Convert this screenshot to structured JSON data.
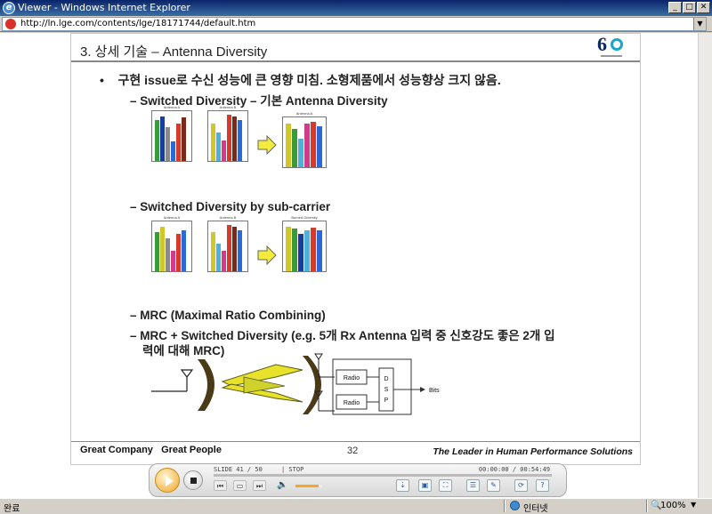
{
  "window": {
    "title": "Viewer - Windows Internet Explorer",
    "minimize": "_",
    "maximize": "□",
    "close": "✕"
  },
  "address": {
    "url": "http://ln.lge.com/contents/lge/18171744/default.htm"
  },
  "slide": {
    "title": "3. 상세 기술 – Antenna Diversity",
    "bullet_main": "구현 issue로 수신 성능에 큰 영향 미침. 소형제품에서 성능향상 크지 않음.",
    "dash_1": "– Switched Diversity – 기본 Antenna Diversity",
    "dash_2": "– Switched Diversity by sub-carrier",
    "dash_3": "– MRC (Maximal Ratio Combining)",
    "dash_4_line1": "– MRC + Switched Diversity (e.g. 5개 Rx Antenna 입력 중 신호강도 좋은 2개 입",
    "dash_4_line2": "력에 대해 MRC)",
    "row1_captions": [
      "Antenna A",
      "Antenna B",
      "Antenna A"
    ],
    "row2_captions": [
      "Antenna A",
      "Antenna B",
      "Burned Diversity"
    ],
    "diagram": {
      "radio_top": "Radio",
      "radio_bottom": "Radio",
      "dsp": "D\nS\nP",
      "output": "Bits"
    },
    "footer_left": "Great Company   Great People",
    "page_number": "32",
    "footer_right": "The Leader in Human Performance Solutions"
  },
  "player": {
    "slide_info": "SLIDE 41 / 50",
    "state": "| STOP",
    "time": "00:00:00 / 00:54:49",
    "volume_level": 0.85
  },
  "statusbar": {
    "status": "완료",
    "zone": "인터넷",
    "zoom": "100%"
  },
  "colors": {
    "bars": [
      "#3a9b3a",
      "#d53a2a",
      "#1a3c9c",
      "#4fb0d8",
      "#d1c72a",
      "#7a2a18",
      "#8a8a8a",
      "#d43a8a",
      "#2a6ad8",
      "#a84ad0"
    ]
  }
}
